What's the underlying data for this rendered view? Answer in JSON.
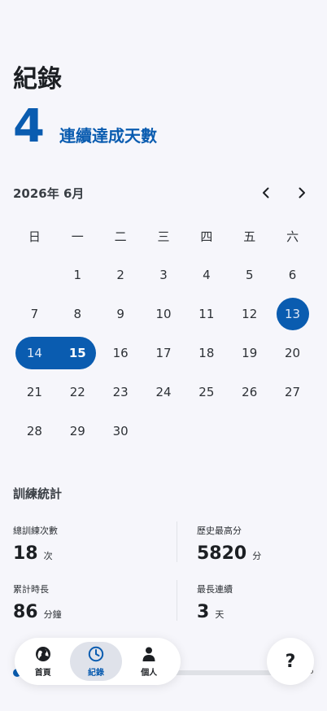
{
  "header": {
    "title": "紀錄"
  },
  "streak": {
    "count": "4",
    "label": "連續達成天數"
  },
  "calendar": {
    "month_label": "2026年 6月",
    "prev_icon": "chevron-left-icon",
    "next_icon": "chevron-right-icon",
    "weekdays": [
      "日",
      "一",
      "二",
      "三",
      "四",
      "五",
      "六"
    ],
    "weeks": [
      [
        "",
        "1",
        "2",
        "3",
        "4",
        "5",
        "6"
      ],
      [
        "7",
        "8",
        "9",
        "10",
        "11",
        "12",
        "13"
      ],
      [
        "14",
        "15",
        "16",
        "17",
        "18",
        "19",
        "20"
      ],
      [
        "21",
        "22",
        "23",
        "24",
        "25",
        "26",
        "27"
      ],
      [
        "28",
        "29",
        "30",
        "",
        "",
        "",
        ""
      ]
    ],
    "streak_days": [
      "13",
      "14",
      "15"
    ],
    "today": "15",
    "accent_color": "#0a5cb0"
  },
  "stats": {
    "title": "訓練統計",
    "items": [
      {
        "label": "總訓練次數",
        "value": "18",
        "unit": "次"
      },
      {
        "label": "歷史最高分",
        "value": "5820",
        "unit": "分"
      },
      {
        "label": "累計時長",
        "value": "86",
        "unit": "分鐘"
      },
      {
        "label": "最長連續",
        "value": "3",
        "unit": "天"
      }
    ]
  },
  "bottom_nav": {
    "items": [
      {
        "label": "首頁",
        "icon": "globe-icon",
        "active": false
      },
      {
        "label": "紀錄",
        "icon": "clock-icon",
        "active": true
      },
      {
        "label": "個人",
        "icon": "person-icon",
        "active": false
      }
    ]
  },
  "help_button": {
    "label": "?"
  }
}
